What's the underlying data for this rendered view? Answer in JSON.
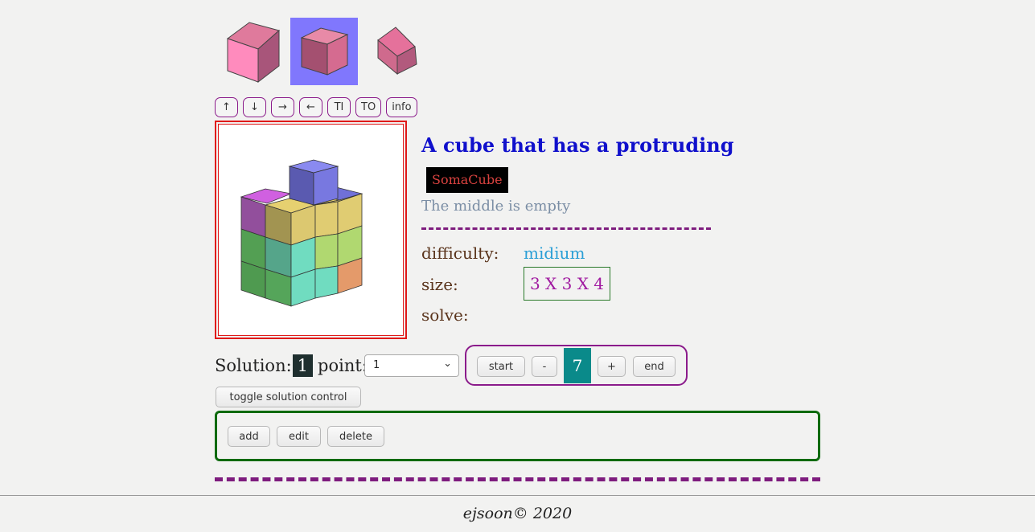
{
  "thumbnails": [
    {
      "name": "thumb-pink-cube",
      "selected": false
    },
    {
      "name": "thumb-dark-pink-cube",
      "selected": true
    },
    {
      "name": "thumb-tilted-pink-cube",
      "selected": false
    }
  ],
  "nav_buttons": [
    "↑",
    "↓",
    "→",
    "←",
    "TI",
    "TO",
    "info"
  ],
  "puzzle": {
    "title": "A cube that has a protruding",
    "tag": "SomaCube",
    "subtitle": "The middle is empty",
    "difficulty_label": "difficulty:",
    "difficulty_value": "midium",
    "size_label": "size:",
    "size_value": "3 X 3 X 4",
    "solve_label": "solve:"
  },
  "solution": {
    "label": "Solution:",
    "number": "1",
    "point_label": "point:",
    "point_selected": "1"
  },
  "stepper": {
    "start_label": "start",
    "minus_label": "-",
    "current": "7",
    "plus_label": "+",
    "end_label": "end"
  },
  "toggle_label": "toggle solution control",
  "edit_controls": {
    "add_label": "add",
    "edit_label": "edit",
    "delete_label": "delete"
  },
  "footer": "ejsoon© 2020",
  "colors": {
    "selected_thumb_bg": "#8077fd",
    "main_border": "#e01a1a",
    "title": "#1010cc",
    "tag_text": "#d9423f",
    "difficulty": "#2a9fd6",
    "size_text": "#a019a0",
    "dash": "#7e1c7e",
    "stepper_border": "#8b1b8b",
    "stepper_value_bg": "#0a8a8a",
    "edit_box_border": "#0e6a0e"
  }
}
